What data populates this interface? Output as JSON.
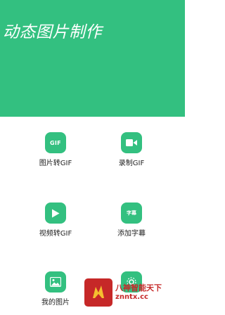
{
  "header": {
    "title": "动态图片制作",
    "background": "#33c080"
  },
  "accent": "#33c080",
  "tiles": [
    {
      "label": "图片转GIF",
      "icon": "gif-badge-icon",
      "icon_text": "GIF"
    },
    {
      "label": "录制GIF",
      "icon": "video-camera-icon"
    },
    {
      "label": "视频转GIF",
      "icon": "play-icon"
    },
    {
      "label": "添加字幕",
      "icon": "subtitle-icon",
      "icon_text": "字幕"
    },
    {
      "label": "我的图片",
      "icon": "image-icon"
    },
    {
      "label": "",
      "icon": "settings-icon"
    }
  ],
  "watermark": {
    "line1": "八神智能天下",
    "line2": "znntx.cc",
    "color": "#c62828"
  }
}
